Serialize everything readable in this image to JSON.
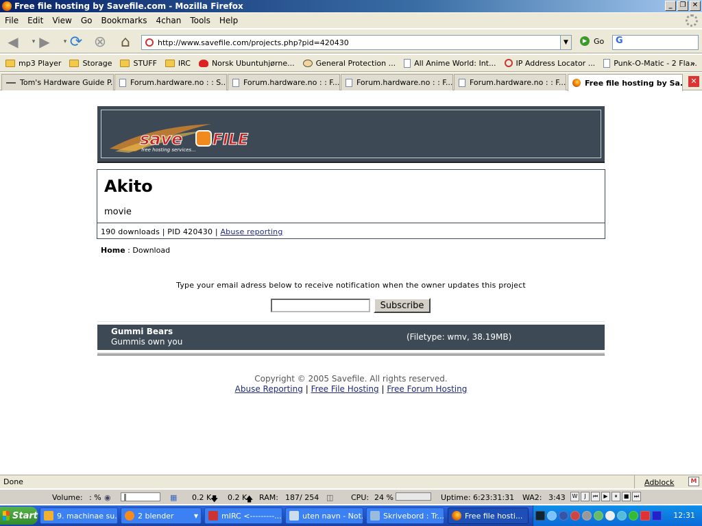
{
  "window": {
    "title": "Free file hosting by Savefile.com - Mozilla Firefox",
    "controls": [
      "_",
      "❐",
      "✕"
    ]
  },
  "menu": [
    "File",
    "Edit",
    "View",
    "Go",
    "Bookmarks",
    "4chan",
    "Tools",
    "Help"
  ],
  "navbar": {
    "url": "http://www.savefile.com/projects.php?pid=420430",
    "go_label": "Go",
    "search_logo": "G"
  },
  "bookmarks": [
    {
      "label": "mp3 Player",
      "icon": "folder"
    },
    {
      "label": "Storage",
      "icon": "folder"
    },
    {
      "label": "STUFF",
      "icon": "folder"
    },
    {
      "label": "IRC",
      "icon": "folder"
    },
    {
      "label": "Norsk Ubuntuhjørne...",
      "icon": "red"
    },
    {
      "label": "General Protection ...",
      "icon": "face"
    },
    {
      "label": "All Anime World: Int...",
      "icon": "page"
    },
    {
      "label": "IP Address Locator ...",
      "icon": "ring"
    },
    {
      "label": "Punk-O-Matic - 2 Fla...",
      "icon": "page"
    }
  ],
  "bookmarks_more": "»",
  "tabs": [
    {
      "label": "Tom's Hardware Guide P..."
    },
    {
      "label": "Forum.hardware.no : : S..."
    },
    {
      "label": "Forum.hardware.no : : F..."
    },
    {
      "label": "Forum.hardware.no : : F..."
    },
    {
      "label": "Forum.hardware.no : : F..."
    },
    {
      "label": "Free file hosting by Sa..."
    }
  ],
  "page": {
    "logo_text": "save",
    "logo_text2": "FILE",
    "logo_tagline": "free hosting services...",
    "project_title": "Akito",
    "project_subtitle": "movie",
    "stats_text": "190 downloads | PID 420430 | ",
    "abuse_link": "Abuse reporting",
    "crumb_home": "Home",
    "crumb_sep": " : ",
    "crumb_current": "Download",
    "notify_text": "Type your email adress below to receive notification when the owner updates this project",
    "subscribe_label": "Subscribe",
    "file": {
      "name": "Gummi Bears",
      "description": "Gummis own you",
      "type": "(Filetype: wmv, 38.19MB)"
    },
    "copyright": "Copyright © 2005 Savefile. All rights reserved.",
    "footer_links": [
      "Abuse Reporting",
      "Free File Hosting",
      "Free Forum Hosting"
    ],
    "footer_sep": "|"
  },
  "statusbar": {
    "text": "Done",
    "adblock": "Adblock",
    "gmail": "M"
  },
  "sysbar": {
    "volume_label": "Volume:",
    "volume_unit": ": %",
    "down": "0.2 K",
    "up": "0.2 K",
    "ram_label": "RAM:",
    "ram_value": "187/ 254",
    "cpu_label": "CPU:",
    "cpu_value": "24 %",
    "uptime_label": "Uptime:",
    "uptime_value": "6:23:31:31",
    "wa_label": "WA2:",
    "wa_value": "3:43",
    "wa_buttons": [
      "W",
      "J",
      "⏮",
      "▶",
      "⏸",
      "■",
      "⏭"
    ]
  },
  "taskbar": {
    "start": "Start",
    "tasks": [
      {
        "label": "9. machinae su..."
      },
      {
        "label": "2 blender"
      },
      {
        "label": "mIRC <---------..."
      },
      {
        "label": "uten navn - Not..."
      },
      {
        "label": "Skrivebord : Tr..."
      },
      {
        "label": "Free file hosti..."
      }
    ],
    "clock": "12:31"
  },
  "colors": {
    "banner": "#3d4a55",
    "link": "#1f2a7a",
    "taskbar": "#245edb"
  }
}
